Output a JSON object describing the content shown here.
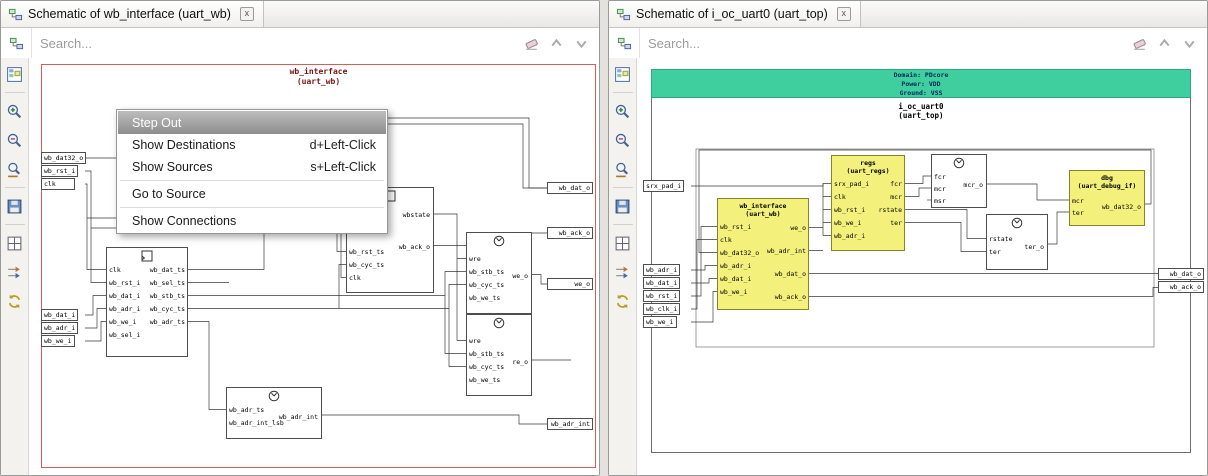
{
  "colors": {
    "frame_red": "#d95c5c",
    "title_dark_red": "#7a1414",
    "block_yellow": "#f3f07b",
    "domain_teal": "#3fcf9f",
    "menu_highlight": "#9a9a9a"
  },
  "icons": {
    "tab": "schematic-diagram",
    "search_options": "schematic-diagram",
    "clear_search": "eraser",
    "find_previous": "arrow-up",
    "find_next": "arrow-down",
    "sidebar": [
      "structure",
      "zoom-in",
      "zoom-out",
      "zoom-selection",
      "save",
      "grid",
      "trace-signal",
      "refresh"
    ],
    "block_flipflop": "flip-flop",
    "block_clock": "clocked-process"
  },
  "left_panel": {
    "tab_title": "Schematic of wb_interface (uart_wb)",
    "search_placeholder": "Search...",
    "schematic": {
      "title": "wb_interface",
      "subtitle": "(uart_wb)",
      "pins_left_top": [
        "wb_dat32_o",
        "wb_rst_i",
        "clk"
      ],
      "pins_left_bottom": [
        "wb_dat_i",
        "wb_adr_i",
        "wb_we_i"
      ],
      "pins_right": [
        "wb_dat_o",
        "wb_ack_o",
        "we_o",
        "wb_adr_int"
      ],
      "reg_block": {
        "ports_left": [
          "clk",
          "wb_rst_i",
          "wb_dat_i",
          "wb_adr_i",
          "wb_we_i",
          "wb_sel_i"
        ],
        "ports_right": [
          "wb_dat_ts",
          "wb_sel_ts",
          "wb_stb_ts",
          "wb_cyc_ts",
          "wb_adr_ts"
        ]
      },
      "state_block": {
        "label": "wbstate",
        "ports_left": [
          "wb_rst_ts",
          "wb_cyc_ts",
          "clk"
        ],
        "ports_right": [
          "wb_ack_o"
        ]
      },
      "we_block": {
        "ports_left": [
          "wre",
          "wb_stb_ts",
          "wb_cyc_ts",
          "wb_we_ts"
        ],
        "ports_right": [
          "we_o"
        ]
      },
      "re_block": {
        "ports_left": [
          "wre",
          "wb_stb_ts",
          "wb_cyc_ts",
          "wb_we_ts"
        ],
        "ports_right": [
          "re_o"
        ]
      },
      "adr_block": {
        "ports_left": [
          "wb_adr_ts",
          "wb_adr_int_lsb"
        ],
        "ports_right": [
          "wb_adr_int"
        ]
      }
    },
    "context_menu": {
      "items": [
        {
          "label": "Step Out",
          "shortcut": ""
        },
        {
          "label": "Show Destinations",
          "shortcut": "d+Left-Click"
        },
        {
          "label": "Show Sources",
          "shortcut": "s+Left-Click"
        },
        {
          "label": "Go to Source",
          "shortcut": ""
        },
        {
          "label": "Show Connections",
          "shortcut": ""
        }
      ]
    }
  },
  "right_panel": {
    "tab_title": "Schematic of i_oc_uart0 (uart_top)",
    "search_placeholder": "Search...",
    "schematic": {
      "domain_header": [
        "Domain: PDcore",
        "Power: VDD",
        "Ground: VSS"
      ],
      "title": "i_oc_uart0",
      "subtitle": "(uart_top)",
      "pins_left_top": [
        "srx_pad_i"
      ],
      "pins_left_bottom": [
        "wb_adr_i",
        "wb_dat_i",
        "wb_rst_i",
        "wb_clk_i",
        "wb_we_i"
      ],
      "pins_right": [
        "wb_dat_o",
        "wb_ack_o"
      ],
      "regs_block": {
        "title": "regs",
        "subtitle": "(uart_regs)",
        "ports_left": [
          "srx_pad_i",
          "clk",
          "wb_rst_i",
          "wb_we_i",
          "wb_adr_i"
        ],
        "ports_right": [
          "fcr",
          "mcr",
          "rstate",
          "ter"
        ]
      },
      "wb_block": {
        "title": "wb_interface",
        "subtitle": "(uart_wb)",
        "ports_left": [
          "wb_rst_i",
          "clk",
          "wb_dat32_o",
          "wb_adr_i",
          "wb_dat_i",
          "wb_we_i"
        ],
        "ports_right": [
          "we_o",
          "wb_adr_int",
          "wb_dat_o",
          "wb_ack_o"
        ]
      },
      "fcr_block": {
        "ports_left": [
          "fcr",
          "mcr",
          "msr"
        ],
        "ports_right": [
          "mcr_o"
        ]
      },
      "ter_block": {
        "ports_left": [
          "rstate",
          "ter"
        ],
        "ports_right": [
          "ter_o"
        ]
      },
      "dbg_block": {
        "title": "dbg",
        "subtitle": "(uart_debug_if)",
        "ports_left": [
          "mcr",
          "ter"
        ],
        "ports_right": [
          "wb_dat32_o"
        ]
      }
    }
  }
}
